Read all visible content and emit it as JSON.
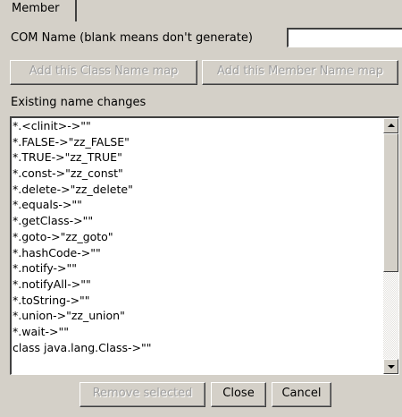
{
  "tab": {
    "label": "Member"
  },
  "com_name": {
    "label": "COM Name (blank means don't generate)",
    "value": ""
  },
  "buttons": {
    "add_class_map": "Add this Class Name map",
    "add_member_map": "Add this Member Name map",
    "remove_selected": "Remove selected",
    "close": "Close",
    "cancel": "Cancel"
  },
  "existing": {
    "label": "Existing name changes",
    "items": [
      "*.<clinit>->\"\"",
      "*.FALSE->\"zz_FALSE\"",
      "*.TRUE->\"zz_TRUE\"",
      "*.const->\"zz_const\"",
      "*.delete->\"zz_delete\"",
      "*.equals->\"\"",
      "*.getClass->\"\"",
      "*.goto->\"zz_goto\"",
      "*.hashCode->\"\"",
      "*.notify->\"\"",
      "*.notifyAll->\"\"",
      "*.toString->\"\"",
      "*.union->\"zz_union\"",
      "*.wait->\"\"",
      "class java.lang.Class->\"\""
    ]
  }
}
